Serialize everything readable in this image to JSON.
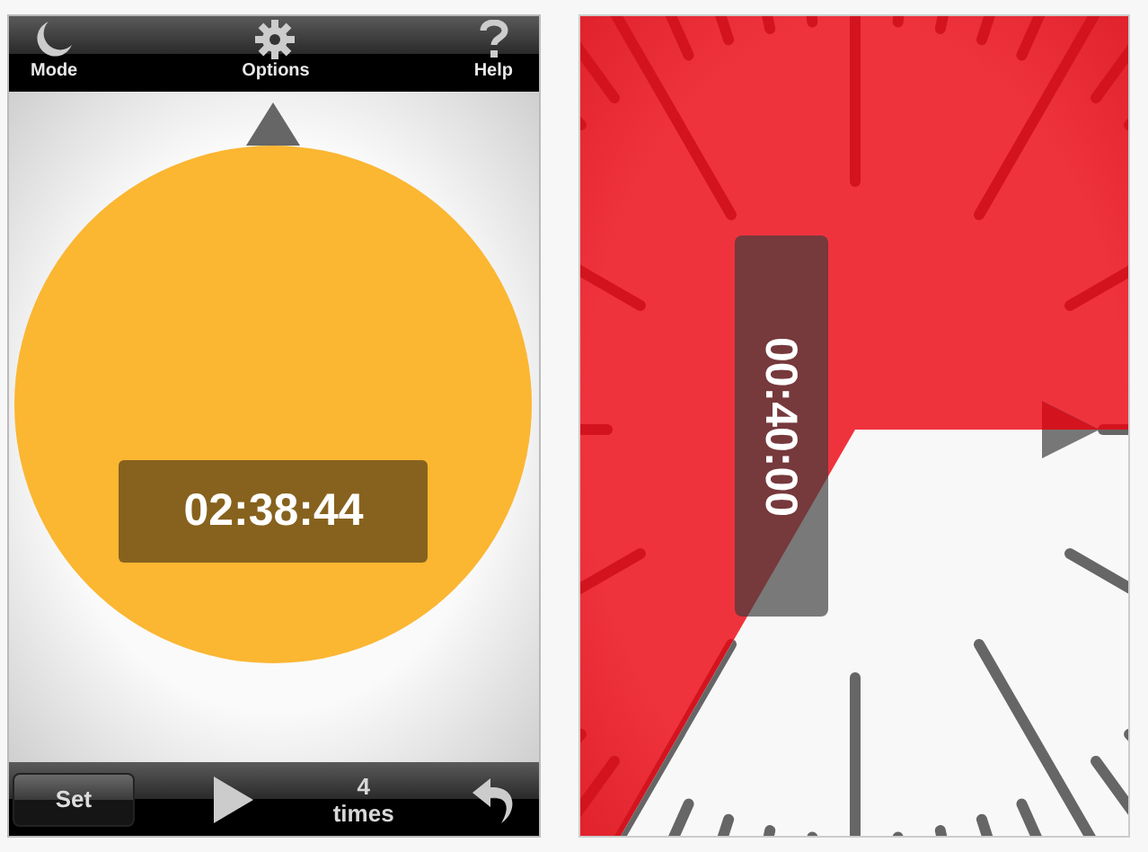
{
  "timer_screen": {
    "toolbar": [
      {
        "kind": "mode",
        "label": "Mode"
      },
      {
        "kind": "options",
        "label": "Options"
      },
      {
        "kind": "help",
        "label": "Help"
      }
    ],
    "time": "02:38:44",
    "bottom_bar": {
      "set_button": "Set",
      "repeat_count": "4",
      "repeat_unit": "times"
    }
  },
  "rotated_screen": {
    "time": "00:40:00"
  }
}
